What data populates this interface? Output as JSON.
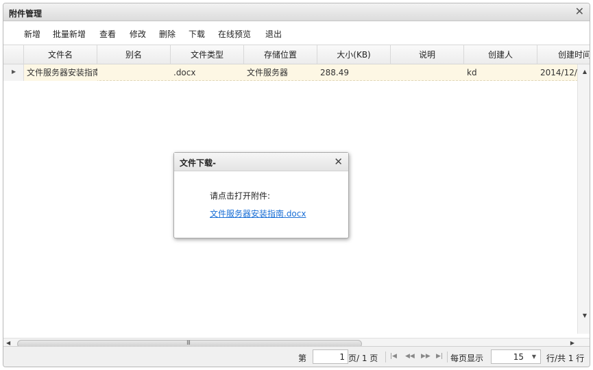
{
  "window": {
    "title": "附件管理",
    "close_icon": "close-icon"
  },
  "toolbar": {
    "buttons": [
      "新增",
      "批量新增",
      "查看",
      "修改",
      "删除",
      "下载",
      "在线预览",
      "退出"
    ]
  },
  "grid": {
    "columns": [
      "文件名",
      "别名",
      "文件类型",
      "存储位置",
      "大小(KB)",
      "说明",
      "创建人",
      "创建时间"
    ],
    "rows": [
      {
        "filename": "文件服务器安装指南",
        "alias": "",
        "type": ".docx",
        "location": "文件服务器",
        "size": "288.49",
        "note": "",
        "creator": "kd",
        "created": "2014/12/"
      }
    ]
  },
  "scrollbar": {
    "grip": "III"
  },
  "pager": {
    "label_page": "第",
    "page_value": "1",
    "label_of": "页/ 1 页",
    "label_per_page": "每页显示",
    "per_page_value": "15",
    "label_total": "行/共 1 行"
  },
  "dialog": {
    "title": "文件下载-",
    "message": "请点击打开附件:",
    "link": "文件服务器安装指南.docx"
  }
}
